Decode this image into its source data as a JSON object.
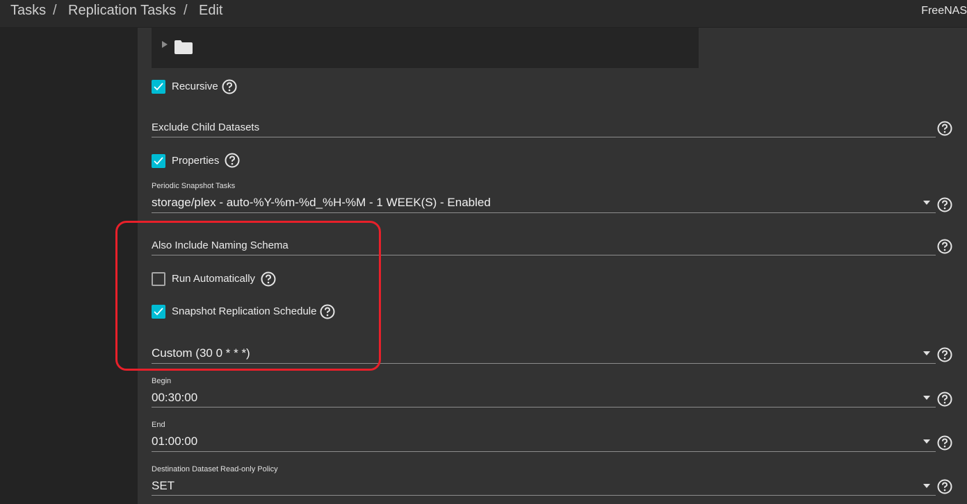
{
  "breadcrumb": {
    "item1": "Tasks",
    "sep1": "/",
    "item2": "Replication Tasks",
    "sep2": "/",
    "item3": "Edit"
  },
  "brand": "FreeNAS",
  "form": {
    "recursive": {
      "label": "Recursive",
      "checked": true
    },
    "exclude_child_datasets": {
      "label": "Exclude Child Datasets",
      "value": ""
    },
    "properties": {
      "label": "Properties",
      "checked": true
    },
    "periodic_snapshot_tasks": {
      "label": "Periodic Snapshot Tasks",
      "value": "storage/plex - auto-%Y-%m-%d_%H-%M - 1 WEEK(S) - Enabled"
    },
    "also_include_naming_schema": {
      "label": "Also Include Naming Schema",
      "value": ""
    },
    "run_automatically": {
      "label": "Run Automatically",
      "checked": false
    },
    "snapshot_replication_schedule": {
      "label": "Snapshot Replication Schedule",
      "checked": true
    },
    "schedule_select": {
      "value": "Custom (30 0 * * *)"
    },
    "begin": {
      "label": "Begin",
      "value": "00:30:00"
    },
    "end": {
      "label": "End",
      "value": "01:00:00"
    },
    "readonly_policy": {
      "label": "Destination Dataset Read-only Policy",
      "value": "SET"
    }
  },
  "colors": {
    "accent": "#00bcd4",
    "highlight": "#e8202a",
    "background": "#333333"
  },
  "icons": {
    "help": "help-circle-icon",
    "folder": "folder-icon",
    "expand": "expand-arrow-icon",
    "check": "check-icon",
    "dropdown": "dropdown-caret-icon"
  }
}
